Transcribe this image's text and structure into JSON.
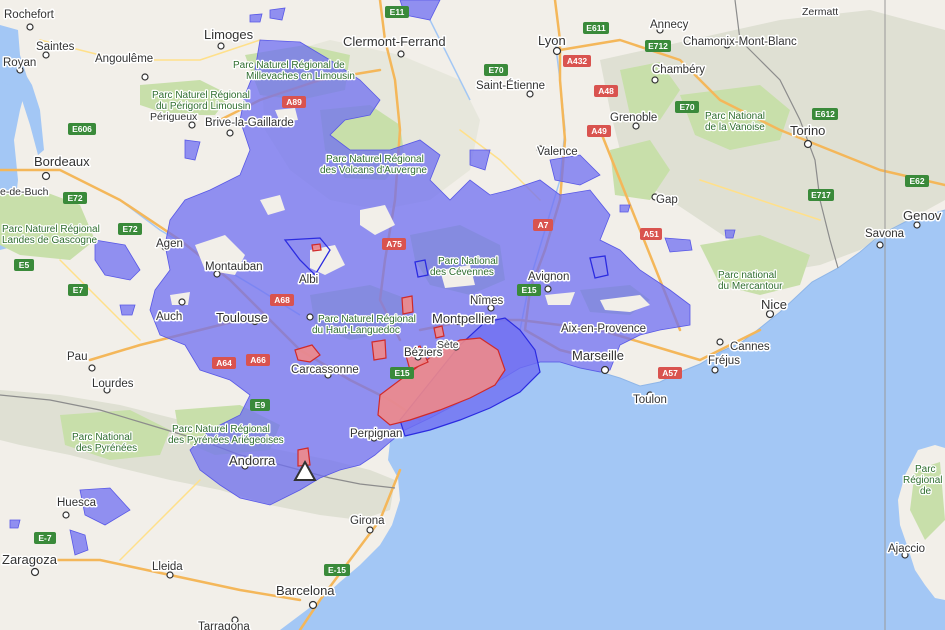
{
  "map": {
    "colors": {
      "land": "#f2efe9",
      "water": "#a3c7f5",
      "park": "#c8dfaa",
      "mountain": "#d6d9cc",
      "coverage_blue": "#6f6ff2",
      "coverage_blue_edge": "#2b2be0",
      "coverage_red": "#f08a8a",
      "coverage_red_edge": "#d02a2a",
      "road_orange": "#f4b75a",
      "road_yellow": "#ffe08a",
      "border": "#8c8c8c",
      "route_shield_green": "#3a8a3a",
      "route_shield_red": "#d9534f"
    },
    "cities": {
      "rochefort": "Rochefort",
      "saintes": "Saintes",
      "royan": "Royan",
      "angouleme": "Angoulême",
      "limoges": "Limoges",
      "clermont": "Clermont-Ferrand",
      "lyon": "Lyon",
      "annecy": "Annecy",
      "chamonix": "Chamonix-Mont-Blanc",
      "zermatt": "Zermatt",
      "chambery": "Chambéry",
      "saint_etienne": "Saint-Étienne",
      "grenoble": "Grenoble",
      "torino": "Torino",
      "perigueux": "Périgueux",
      "brive": "Brive-la-Gaillarde",
      "bordeaux": "Bordeaux",
      "tete_de_buch": "e-de-Buch",
      "valence": "Valence",
      "gap": "Gap",
      "agen": "Agen",
      "genova": "Genov",
      "savona": "Savona",
      "montauban": "Montauban",
      "albi": "Albi",
      "avignon": "Avignon",
      "nimes": "Nîmes",
      "auch": "Auch",
      "toulouse": "Toulouse",
      "montpellier": "Montpellier",
      "nice": "Nice",
      "aix": "Aix-en-Provence",
      "cannes": "Cannes",
      "beziers": "Béziers",
      "sete": "Sète",
      "marseille": "Marseille",
      "frejus": "Fréjus",
      "pau": "Pau",
      "carcassonne": "Carcassonne",
      "lourdes": "Lourdes",
      "toulon": "Toulon",
      "perpignan": "Perpignan",
      "andorra": "Andorra",
      "huesca": "Huesca",
      "girona": "Girona",
      "zaragoza": "Zaragoza",
      "lleida": "Lleida",
      "barcelona": "Barcelona",
      "tarragona": "Tarragona",
      "ajaccio": "Ajaccio"
    },
    "parks": {
      "millevaches_1": "Parc Naturel Régional de",
      "millevaches_2": "Millevaches en Limousin",
      "perigord_1": "Parc Naturel Régional",
      "perigord_2": "du Périgord Limousin",
      "volcans_1": "Parc Naturel Régional",
      "volcans_2": "des Volcans d'Auvergne",
      "landes_1": "Parc Naturel Régional",
      "landes_2": "Landes de Gascogne",
      "cevennes_1": "Parc National",
      "cevennes_2": "des Cévennes",
      "vanoise_1": "Parc National",
      "vanoise_2": "de la Vanoise",
      "mercantour_1": "Parc national",
      "mercantour_2": "du Mercantour",
      "haut_languedoc_1": "Parc Naturel Régional",
      "haut_languedoc_2": "du Haut-Languedoc",
      "pyrenees_1": "Parc National",
      "pyrenees_2": "des Pyrénées",
      "pyrenees_ariegeoises_1": "Parc Naturel Régional",
      "pyrenees_ariegeoises_2": "des Pyrénées Ariégeoises",
      "corse_1": "Parc",
      "corse_2": "Régional",
      "corse_3": "de"
    },
    "routes": {
      "e11": "E11",
      "e611": "E611",
      "e712": "E712",
      "a432": "A432",
      "e70_a": "E70",
      "a48": "A48",
      "e70_b": "E70",
      "a49": "A49",
      "e612": "E612",
      "a89": "A89",
      "e606": "E606",
      "e72_a": "E72",
      "e72_b": "E72",
      "e717": "E717",
      "e62": "E62",
      "a7": "A7",
      "a51": "A51",
      "a75": "A75",
      "e5": "E5",
      "e7": "E7",
      "a68": "A68",
      "e15_a": "E15",
      "a66": "A66",
      "a64": "A64",
      "e15_b": "E15",
      "a57": "A57",
      "e9": "E9",
      "e7_es": "E-7",
      "e15_es": "E-15"
    },
    "marker": {
      "name": "transmitter-marker",
      "icon": "triangle-marker-icon"
    }
  }
}
